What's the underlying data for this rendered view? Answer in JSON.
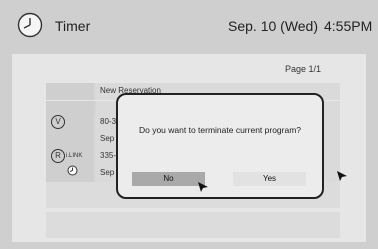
{
  "header": {
    "app_icon": "clock-icon",
    "title": "Timer",
    "date": "Sep. 10 (Wed)",
    "time": "4:55PM"
  },
  "list": {
    "page_label": "Page 1/1",
    "rows": [
      {
        "text": "New Reservation"
      },
      {
        "badge": "V",
        "text": "80-3"
      },
      {
        "text": "Sep"
      },
      {
        "badge": "R",
        "badge_label": "i.LINK",
        "text": "335-"
      },
      {
        "icon": "clock-icon",
        "text": "Sep"
      }
    ]
  },
  "dialog": {
    "message": "Do you want to terminate current program?",
    "no_label": "No",
    "yes_label": "Yes",
    "selected": "No"
  }
}
